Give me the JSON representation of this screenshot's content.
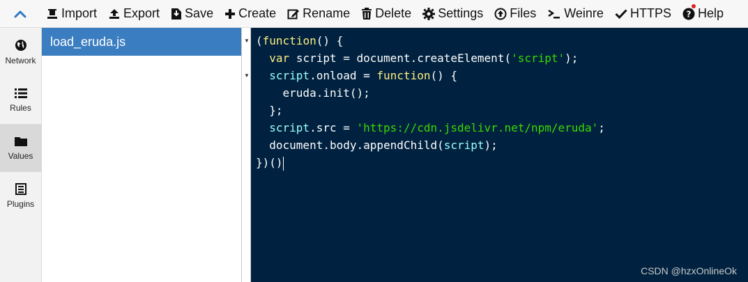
{
  "toolbar": {
    "import_label": "Import",
    "export_label": "Export",
    "save_label": "Save",
    "create_label": "Create",
    "rename_label": "Rename",
    "delete_label": "Delete",
    "settings_label": "Settings",
    "files_label": "Files",
    "weinre_label": "Weinre",
    "https_label": "HTTPS",
    "help_label": "Help"
  },
  "leftnav": {
    "items": [
      {
        "label": "Network",
        "icon": "globe-icon"
      },
      {
        "label": "Rules",
        "icon": "list-icon"
      },
      {
        "label": "Values",
        "icon": "folder-icon"
      },
      {
        "label": "Plugins",
        "icon": "plugins-icon"
      }
    ],
    "active": "Values"
  },
  "files": {
    "items": [
      {
        "name": "load_eruda.js",
        "selected": true
      }
    ]
  },
  "editor": {
    "lines": [
      "(function() {",
      "  var script = document.createElement('script');",
      "  script.onload = function() {",
      "    eruda.init();",
      "  };",
      "  script.src = 'https://cdn.jsdelivr.net/npm/eruda';",
      "  document.body.appendChild(script);",
      "})()"
    ],
    "colors": {
      "background": "#002240",
      "keyword": "#ffee80",
      "string": "#3ad900",
      "variable": "#9effff"
    }
  },
  "watermark": "CSDN @hzxOnlineOk",
  "colors": {
    "accent": "#3a7dc0",
    "collapse": "#2b79c2"
  }
}
